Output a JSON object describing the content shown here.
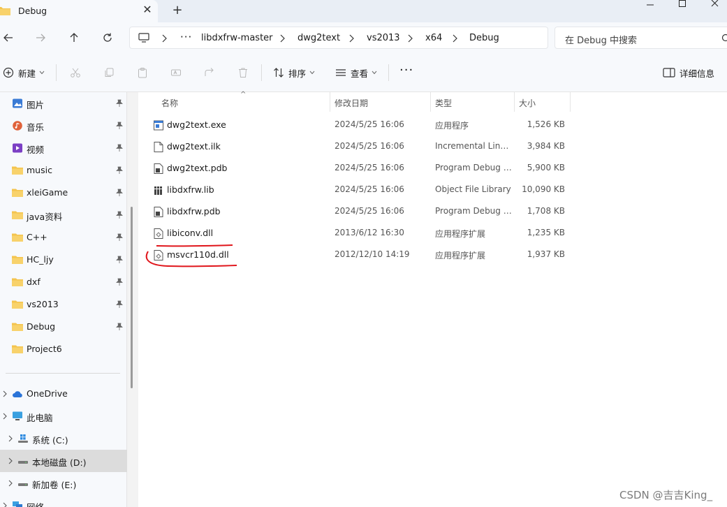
{
  "tab": {
    "title": "Debug",
    "close_glyph": "✕",
    "new_tab_glyph": "+"
  },
  "address": {
    "crumbs": [
      "libdxfrw-master",
      "dwg2text",
      "vs2013",
      "x64",
      "Debug"
    ],
    "more_glyph": "···"
  },
  "search": {
    "placeholder": "在 Debug 中搜索"
  },
  "commands": {
    "new_label": "新建",
    "sort_label": "排序",
    "view_label": "查看",
    "more_glyph": "···",
    "details_label": "详细信息"
  },
  "sidebar": {
    "quick": [
      {
        "label": "图片",
        "icon": "pictures-icon",
        "color": "#3a7bd5"
      },
      {
        "label": "音乐",
        "icon": "music-icon",
        "color": "#e0623a"
      },
      {
        "label": "视频",
        "icon": "videos-icon",
        "color": "#7b3fc4"
      },
      {
        "label": "music",
        "icon": "folder-icon",
        "color": "#f4c44e"
      },
      {
        "label": "xleiGame",
        "icon": "folder-icon",
        "color": "#f4c44e"
      },
      {
        "label": "java资料",
        "icon": "folder-icon",
        "color": "#f4c44e"
      },
      {
        "label": "C++",
        "icon": "folder-icon",
        "color": "#f4c44e"
      },
      {
        "label": "HC_ljy",
        "icon": "folder-icon",
        "color": "#f4c44e"
      },
      {
        "label": "dxf",
        "icon": "folder-icon",
        "color": "#f4c44e"
      },
      {
        "label": "vs2013",
        "icon": "folder-icon",
        "color": "#f4c44e"
      },
      {
        "label": "Debug",
        "icon": "folder-icon",
        "color": "#f4c44e"
      },
      {
        "label": "Project6",
        "icon": "folder-icon",
        "color": "#f4c44e"
      }
    ],
    "tree": [
      {
        "label": "OneDrive",
        "icon": "cloud-icon"
      },
      {
        "label": "此电脑",
        "icon": "computer-icon"
      },
      {
        "label": "系统 (C:)",
        "icon": "windows-drive-icon"
      },
      {
        "label": "本地磁盘 (D:)",
        "icon": "drive-icon",
        "selected": true
      },
      {
        "label": "新加卷 (E:)",
        "icon": "drive-icon"
      },
      {
        "label": "网络",
        "icon": "network-icon"
      }
    ]
  },
  "columns": {
    "name": "名称",
    "date": "修改日期",
    "type": "类型",
    "size": "大小"
  },
  "files": [
    {
      "name": "dwg2text.exe",
      "date": "2024/5/25 16:06",
      "type": "应用程序",
      "size": "1,526 KB",
      "icon": "exe-icon"
    },
    {
      "name": "dwg2text.ilk",
      "date": "2024/5/25 16:06",
      "type": "Incremental Linker File",
      "size": "3,984 KB",
      "icon": "file-icon"
    },
    {
      "name": "dwg2text.pdb",
      "date": "2024/5/25 16:06",
      "type": "Program Debug Database",
      "size": "5,900 KB",
      "icon": "pdb-icon"
    },
    {
      "name": "libdxfrw.lib",
      "date": "2024/5/25 16:06",
      "type": "Object File Library",
      "size": "10,090 KB",
      "icon": "lib-icon"
    },
    {
      "name": "libdxfrw.pdb",
      "date": "2024/5/25 16:06",
      "type": "Program Debug Database",
      "size": "1,708 KB",
      "icon": "pdb-icon"
    },
    {
      "name": "libiconv.dll",
      "date": "2013/6/12 16:30",
      "type": "应用程序扩展",
      "size": "1,235 KB",
      "icon": "dll-icon"
    },
    {
      "name": "msvcr110d.dll",
      "date": "2012/12/10 14:19",
      "type": "应用程序扩展",
      "size": "1,937 KB",
      "icon": "dll-icon"
    }
  ],
  "watermark": "CSDN @吉吉King_",
  "colors": {
    "annotation": "#e0151b",
    "accent": "#3a7bd5",
    "folder": "#f4c44e"
  }
}
